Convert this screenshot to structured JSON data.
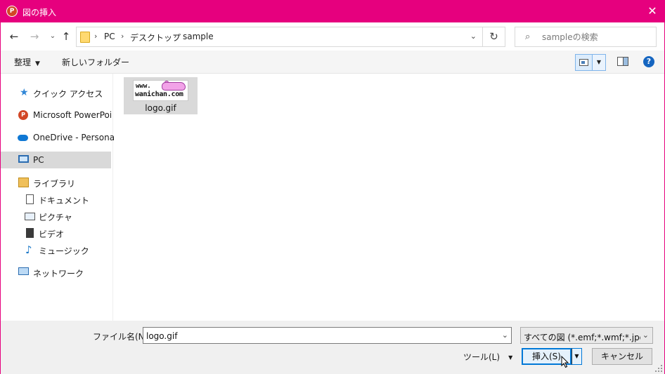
{
  "window": {
    "title": "図の挿入",
    "app_icon": "powerpoint-icon",
    "app_icon_letter": "P",
    "close_icon": "✕",
    "accent_color": "#e6007e"
  },
  "navigation": {
    "back_icon": "←",
    "forward_icon": "→",
    "recent_icon": "⌄",
    "up_icon": "↑",
    "breadcrumb": [
      "PC",
      "デスクトップ",
      "sample"
    ],
    "separator": "›",
    "address_dropdown": "⌄",
    "refresh_icon": "↻",
    "search_placeholder": "sampleの検索",
    "search_icon": "⌕"
  },
  "command_bar": {
    "organize_label": "整理",
    "organize_caret": "▼",
    "new_folder_label": "新しいフォルダー",
    "view_dropdown_caret": "▼",
    "help_label": "?"
  },
  "sidebar": {
    "items": [
      {
        "label": "クイック アクセス",
        "icon": "quick-access-star-icon",
        "glyph": "★"
      },
      {
        "label": "Microsoft PowerPoint",
        "icon": "powerpoint-icon",
        "glyph": "P"
      },
      {
        "label": "OneDrive - Personal",
        "icon": "onedrive-cloud-icon"
      },
      {
        "label": "PC",
        "icon": "pc-icon",
        "selected": true
      },
      {
        "label": "ライブラリ",
        "icon": "library-icon"
      },
      {
        "label": "ドキュメント",
        "icon": "documents-icon"
      },
      {
        "label": "ピクチャ",
        "icon": "pictures-icon"
      },
      {
        "label": "ビデオ",
        "icon": "videos-icon"
      },
      {
        "label": "ミュージック",
        "icon": "music-icon",
        "glyph": "♪"
      },
      {
        "label": "ネットワーク",
        "icon": "network-icon"
      }
    ]
  },
  "files": [
    {
      "name": "logo.gif",
      "thumb_line1": "www.",
      "thumb_line2": "wanichan.com",
      "selected": true
    }
  ],
  "footer": {
    "filename_label": "ファイル名(N):",
    "filename_value": "logo.gif",
    "filename_dropdown": "⌄",
    "filetype_value": "すべての図 (*.emf;*.wmf;*.jpg;*.jpeg;*.jfif;*.jpe;*.png;*.bmp;*.dib;*.rle;*.gif;*.emz;*.wmz;*.svg;*.ico)",
    "filetype_dropdown": "⌄",
    "tools_label": "ツール(L)",
    "tools_caret": "▼",
    "insert_label": "挿入(S)",
    "insert_split_caret": "▼",
    "cancel_label": "キャンセル"
  }
}
